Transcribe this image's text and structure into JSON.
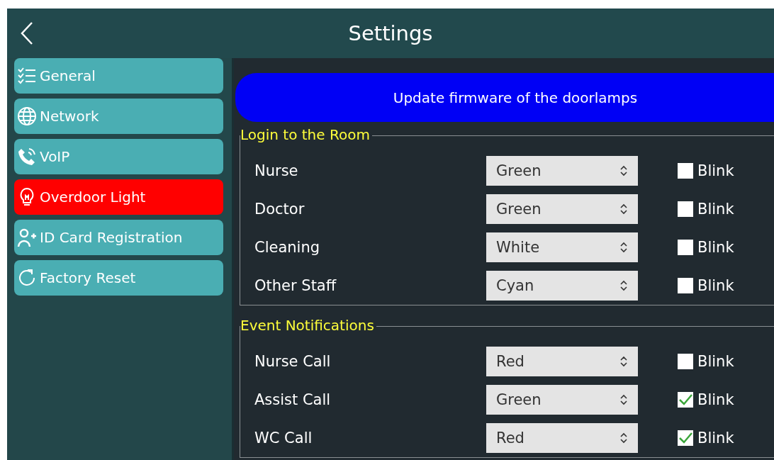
{
  "header": {
    "title": "Settings"
  },
  "sidebar": {
    "items": [
      {
        "label": "General",
        "selected": false
      },
      {
        "label": "Network",
        "selected": false
      },
      {
        "label": "VoIP",
        "selected": false
      },
      {
        "label": "Overdoor Light",
        "selected": true
      },
      {
        "label": "ID Card Registration",
        "selected": false
      },
      {
        "label": "Factory Reset",
        "selected": false
      }
    ]
  },
  "update_button": "Update firmware of the doorlamps",
  "sections": [
    {
      "title": "Login to the Room",
      "rows": [
        {
          "label": "Nurse",
          "value": "Green",
          "checkbox_label": "Blink",
          "checked": false
        },
        {
          "label": "Doctor",
          "value": "Green",
          "checkbox_label": "Blink",
          "checked": false
        },
        {
          "label": "Cleaning",
          "value": "White",
          "checkbox_label": "Blink",
          "checked": false
        },
        {
          "label": "Other Staff",
          "value": "Cyan",
          "checkbox_label": "Blink",
          "checked": false
        }
      ]
    },
    {
      "title": "Event Notifications",
      "rows": [
        {
          "label": "Nurse Call",
          "value": "Red",
          "checkbox_label": "Blink",
          "checked": false
        },
        {
          "label": "Assist Call",
          "value": "Green",
          "checkbox_label": "Blink",
          "checked": true
        },
        {
          "label": "WC Call",
          "value": "Red",
          "checkbox_label": "Blink",
          "checked": true
        }
      ]
    }
  ]
}
